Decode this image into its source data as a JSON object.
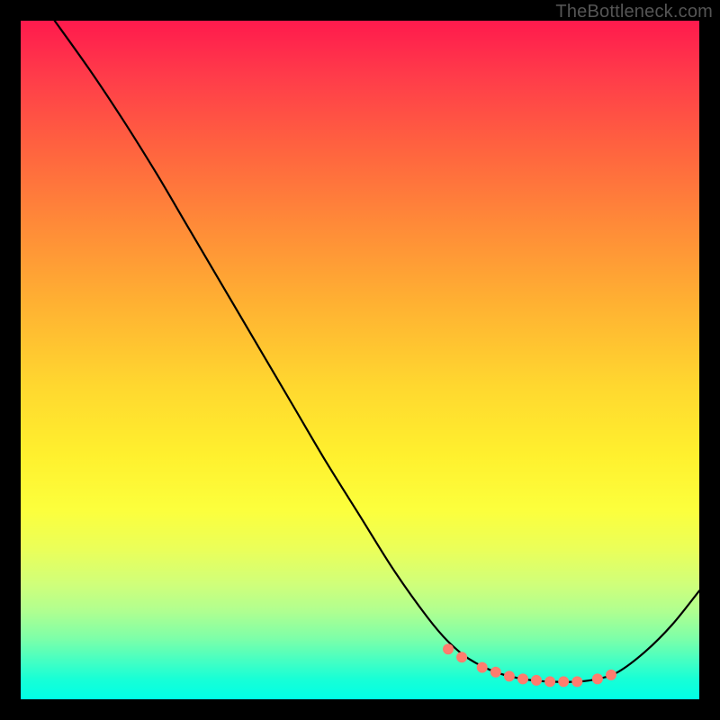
{
  "watermark": "TheBottleneck.com",
  "chart_data": {
    "type": "line",
    "title": "",
    "xlabel": "",
    "ylabel": "",
    "xlim": [
      0,
      100
    ],
    "ylim": [
      0,
      100
    ],
    "series": [
      {
        "name": "curve",
        "x": [
          5,
          10,
          15,
          20,
          25,
          30,
          35,
          40,
          45,
          50,
          55,
          60,
          63,
          66,
          70,
          74,
          78,
          82,
          85,
          88,
          92,
          96,
          100
        ],
        "y": [
          100,
          93,
          85.5,
          77.5,
          69,
          60.5,
          52,
          43.5,
          35,
          27,
          19,
          12,
          8.5,
          6,
          4,
          3,
          2.6,
          2.6,
          3,
          4,
          7,
          11,
          16
        ]
      }
    ],
    "markers": {
      "name": "optimal-zone-dots",
      "x": [
        63,
        65,
        68,
        70,
        72,
        74,
        76,
        78,
        80,
        82,
        85,
        87
      ],
      "y": [
        7.4,
        6.2,
        4.7,
        4,
        3.4,
        3,
        2.8,
        2.6,
        2.6,
        2.6,
        3,
        3.6
      ]
    }
  }
}
